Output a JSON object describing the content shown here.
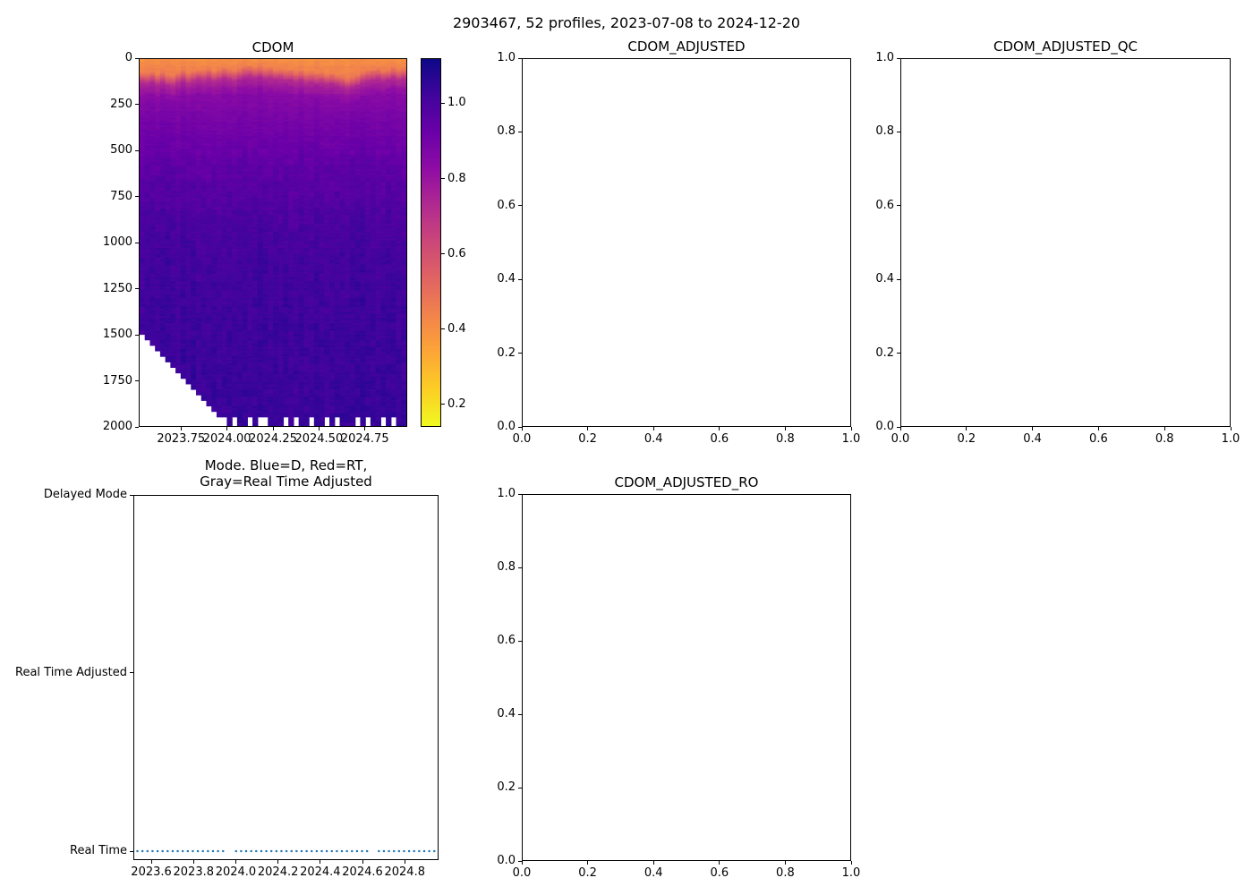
{
  "figure": {
    "suptitle": "2903467, 52 profiles, 2023-07-08 to 2024-12-20",
    "background_color": "#ffffff",
    "text_color": "#000000"
  },
  "chart_data": [
    {
      "id": "cdom",
      "type": "heatmap",
      "title": "CDOM",
      "x_range": [
        2023.52,
        2024.98
      ],
      "x_ticks": [
        2023.75,
        2024.0,
        2024.25,
        2024.5,
        2024.75
      ],
      "x_tick_labels": [
        "2023.75",
        "2024.00",
        "2024.25",
        "2024.50",
        "2024.75"
      ],
      "y_range": [
        0,
        2000
      ],
      "y_inverted": true,
      "y_ticks": [
        0,
        250,
        500,
        750,
        1000,
        1250,
        1500,
        1750,
        2000
      ],
      "y_tick_labels": [
        "0",
        "250",
        "500",
        "750",
        "1000",
        "1250",
        "1500",
        "1750",
        "2000"
      ],
      "n_profiles": 52,
      "colormap": "plasma_r",
      "colormap_stops": [
        "#0d0887",
        "#41049d",
        "#6a00a8",
        "#8f0da4",
        "#b12a90",
        "#cc4778",
        "#e16462",
        "#f2844b",
        "#fca636",
        "#fcce25",
        "#f0f921"
      ],
      "vmin": 0.14,
      "vmax": 1.12,
      "colorbar_ticks": [
        1.0,
        0.8,
        0.6,
        0.4,
        0.2
      ],
      "colorbar_tick_labels": [
        "1.0",
        "0.8",
        "0.6",
        "0.4",
        "0.2"
      ],
      "value_at_surface": 0.4,
      "mixed_layer_value": 0.45,
      "transition_anchors_below_mixed_layer": [
        [
          0,
          0.45
        ],
        [
          25,
          0.56
        ],
        [
          60,
          0.73
        ],
        [
          140,
          0.845
        ]
      ],
      "depth_value_anchors": [
        [
          350,
          0.895
        ],
        [
          600,
          0.95
        ],
        [
          900,
          1.0
        ],
        [
          1300,
          1.025
        ],
        [
          2000,
          1.04
        ]
      ],
      "mixed_layer_depth_by_profile": [
        70,
        75,
        65,
        80,
        70,
        85,
        90,
        70,
        60,
        75,
        65,
        55,
        60,
        50,
        65,
        55,
        45,
        55,
        60,
        50,
        40,
        35,
        45,
        40,
        50,
        45,
        55,
        50,
        60,
        55,
        65,
        60,
        70,
        65,
        75,
        70,
        80,
        75,
        85,
        90,
        100,
        95,
        85,
        70,
        60,
        55,
        50,
        60,
        55,
        45,
        55,
        50
      ],
      "max_depth_by_profile": [
        1500,
        1530,
        1560,
        1590,
        1620,
        1650,
        1680,
        1710,
        1740,
        1770,
        1800,
        1830,
        1860,
        1890,
        1920,
        1950,
        1950,
        2000,
        1950,
        2000,
        2000,
        1950,
        2000,
        1950,
        1950,
        2000,
        2000,
        2000,
        1950,
        2000,
        1950,
        2000,
        2000,
        1950,
        2000,
        2000,
        1950,
        2000,
        1950,
        2000,
        2000,
        2000,
        1950,
        2000,
        1950,
        2000,
        2000,
        1950,
        2000,
        1950,
        2000,
        2000
      ]
    },
    {
      "id": "cdom_adjusted",
      "type": "empty",
      "title": "CDOM_ADJUSTED",
      "x_range": [
        0,
        1
      ],
      "y_range": [
        0,
        1
      ],
      "x_ticks": [
        0.0,
        0.2,
        0.4,
        0.6,
        0.8,
        1.0
      ],
      "x_tick_labels": [
        "0.0",
        "0.2",
        "0.4",
        "0.6",
        "0.8",
        "1.0"
      ],
      "y_ticks": [
        0.0,
        0.2,
        0.4,
        0.6,
        0.8,
        1.0
      ],
      "y_tick_labels": [
        "0.0",
        "0.2",
        "0.4",
        "0.6",
        "0.8",
        "1.0"
      ]
    },
    {
      "id": "cdom_adjusted_qc",
      "type": "empty",
      "title": "CDOM_ADJUSTED_QC",
      "x_range": [
        0,
        1
      ],
      "y_range": [
        0,
        1
      ],
      "x_ticks": [
        0.0,
        0.2,
        0.4,
        0.6,
        0.8,
        1.0
      ],
      "x_tick_labels": [
        "0.0",
        "0.2",
        "0.4",
        "0.6",
        "0.8",
        "1.0"
      ],
      "y_ticks": [
        0.0,
        0.2,
        0.4,
        0.6,
        0.8,
        1.0
      ],
      "y_tick_labels": [
        "0.0",
        "0.2",
        "0.4",
        "0.6",
        "0.8",
        "1.0"
      ]
    },
    {
      "id": "mode",
      "type": "scatter",
      "title": "Mode. Blue=D, Red=RT,\nGray=Real Time Adjusted",
      "x_range": [
        2023.515,
        2024.96
      ],
      "x_ticks": [
        2023.6,
        2023.8,
        2024.0,
        2024.2,
        2024.4,
        2024.6,
        2024.8
      ],
      "x_tick_labels": [
        "2023.6",
        "2023.8",
        "2024.0",
        "2024.2",
        "2024.4",
        "2024.6",
        "2024.8"
      ],
      "y_categories": [
        "Delayed Mode",
        "Real Time Adjusted",
        "Real Time"
      ],
      "y_category_fractions": [
        0,
        0.4877,
        0.9755
      ],
      "series": [
        {
          "name": "Real Time",
          "color": "#1f77b4",
          "y_category": "Real Time",
          "style": "dotted",
          "dot_spacing_years": 0.024,
          "x_runs": [
            [
              2023.53,
              2023.96
            ],
            [
              2024.0,
              2024.64
            ],
            [
              2024.68,
              2024.95
            ]
          ]
        }
      ]
    },
    {
      "id": "cdom_adjusted_ro",
      "type": "empty",
      "title": "CDOM_ADJUSTED_RO",
      "x_range": [
        0,
        1
      ],
      "y_range": [
        0,
        1
      ],
      "x_ticks": [
        0.0,
        0.2,
        0.4,
        0.6,
        0.8,
        1.0
      ],
      "x_tick_labels": [
        "0.0",
        "0.2",
        "0.4",
        "0.6",
        "0.8",
        "1.0"
      ],
      "y_ticks": [
        0.0,
        0.2,
        0.4,
        0.6,
        0.8,
        1.0
      ],
      "y_tick_labels": [
        "0.0",
        "0.2",
        "0.4",
        "0.6",
        "0.8",
        "1.0"
      ]
    }
  ]
}
